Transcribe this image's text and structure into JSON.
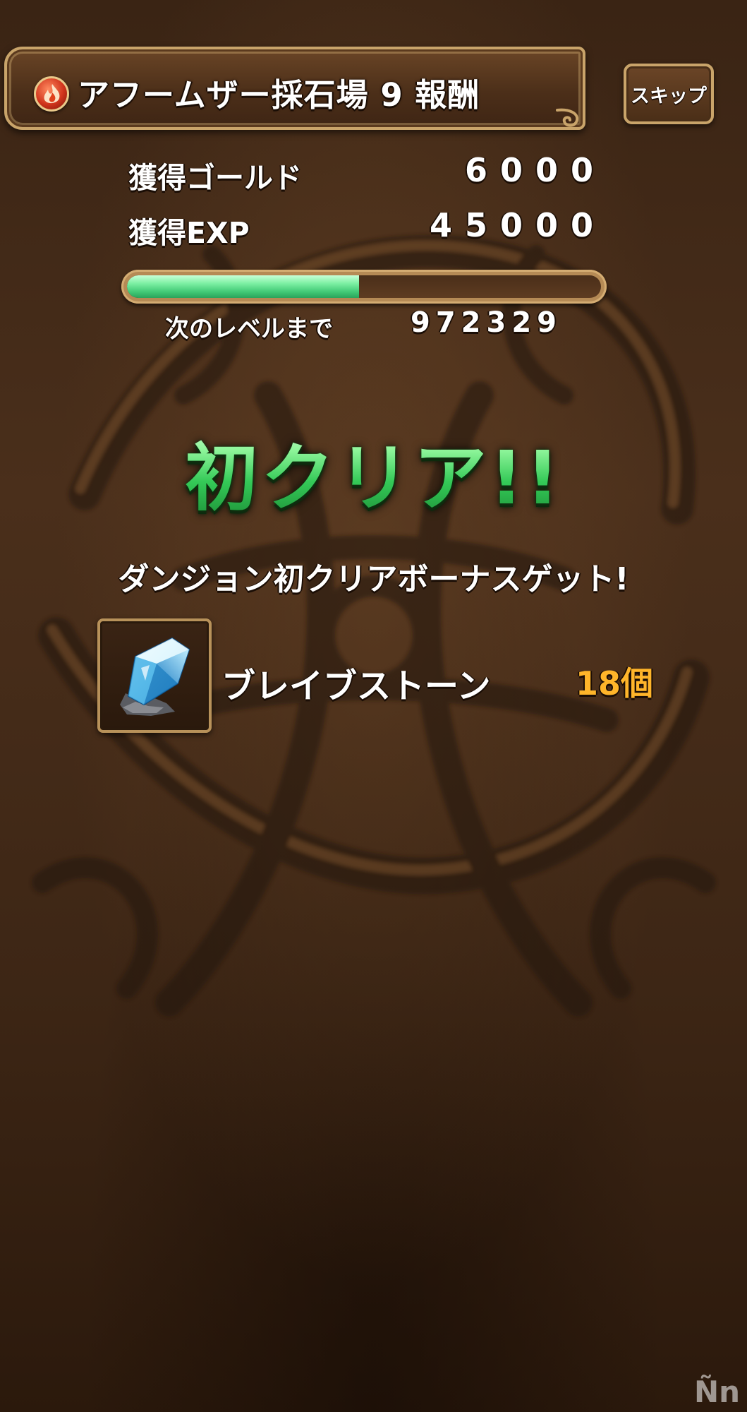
{
  "header": {
    "title": "アフームザー採石場 9 報酬",
    "element_icon": "fire-element-icon",
    "skip_label": "スキップ"
  },
  "rewards": {
    "gold_label": "獲得ゴールド",
    "gold_value": "6000",
    "exp_label": "獲得EXP",
    "exp_value": "45000"
  },
  "level": {
    "progress_fraction": 0.49,
    "next_level_label": "次のレベルまで",
    "next_level_value": "972329"
  },
  "first_clear": {
    "banner": "初クリア!!",
    "bonus_text": "ダンジョン初クリアボーナスゲット!",
    "item_icon": "brave-stone-icon",
    "item_name": "ブレイブストーン",
    "item_qty": "18個"
  },
  "watermark": "Ñn",
  "colors": {
    "exp_fill": "#3fc774",
    "first_clear_green": "#55e07c",
    "quantity_orange": "#ffb52a",
    "frame_gold": "#c9a46a"
  }
}
